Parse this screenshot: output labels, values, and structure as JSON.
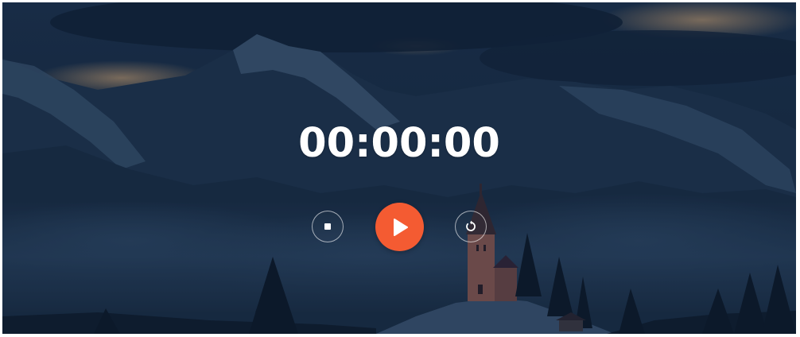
{
  "stopwatch": {
    "time_display": "00:00:00"
  },
  "controls": {
    "stop": {
      "icon": "stop-icon"
    },
    "play": {
      "icon": "play-icon",
      "color": "#f45b32"
    },
    "reset": {
      "icon": "reset-icon"
    }
  },
  "background": {
    "description_colors": {
      "overlay": "#12243a",
      "sky_glow": "#c9a277"
    }
  }
}
